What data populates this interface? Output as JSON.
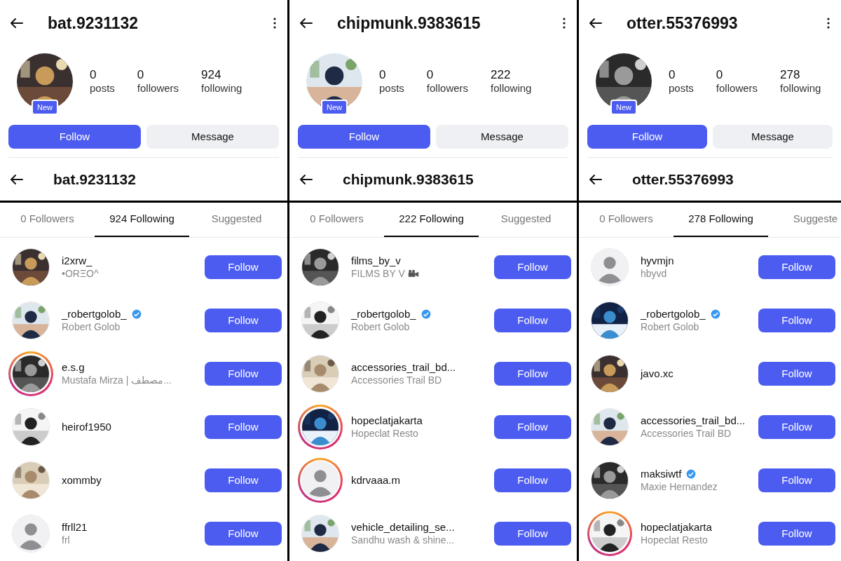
{
  "panels": [
    {
      "profile": {
        "username": "bat.9231132",
        "badge": "New",
        "stats": [
          {
            "value": "0",
            "label": "posts"
          },
          {
            "value": "0",
            "label": "followers"
          },
          {
            "value": "924",
            "label": "following"
          }
        ],
        "follow": "Follow",
        "message": "Message"
      },
      "list_title": "bat.9231132",
      "tabs": [
        {
          "label": "0 Followers",
          "selected": false
        },
        {
          "label": "924 Following",
          "selected": true
        },
        {
          "label": "Suggested",
          "selected": false
        }
      ],
      "users": [
        {
          "username": "i2xrw_",
          "subtitle": "•ORΞO^",
          "verified": false,
          "story_ring": false,
          "has_photo": true,
          "follow": "Follow"
        },
        {
          "username": "_robertgolob_",
          "subtitle": "Robert Golob",
          "verified": true,
          "story_ring": false,
          "has_photo": true,
          "follow": "Follow"
        },
        {
          "username": "e.s.g",
          "subtitle": "Mustafa Mirza | مصطف...",
          "verified": false,
          "story_ring": true,
          "has_photo": true,
          "follow": "Follow"
        },
        {
          "username": "heirof1950",
          "verified": false,
          "story_ring": false,
          "has_photo": true,
          "follow": "Follow"
        },
        {
          "username": "xommby",
          "verified": false,
          "story_ring": false,
          "has_photo": true,
          "follow": "Follow"
        },
        {
          "username": "ffrll21",
          "subtitle": "frl",
          "verified": false,
          "story_ring": false,
          "has_photo": false,
          "follow": "Follow"
        }
      ]
    },
    {
      "profile": {
        "username": "chipmunk.9383615",
        "badge": "New",
        "stats": [
          {
            "value": "0",
            "label": "posts"
          },
          {
            "value": "0",
            "label": "followers"
          },
          {
            "value": "222",
            "label": "following"
          }
        ],
        "follow": "Follow",
        "message": "Message"
      },
      "list_title": "chipmunk.9383615",
      "tabs": [
        {
          "label": "0 Followers",
          "selected": false
        },
        {
          "label": "222 Following",
          "selected": true
        },
        {
          "label": "Suggested",
          "selected": false
        }
      ],
      "users": [
        {
          "username": "films_by_v",
          "subtitle": "FILMS BY V",
          "verified": false,
          "story_ring": false,
          "has_photo": true,
          "follow": "Follow"
        },
        {
          "username": "_robertgolob_",
          "subtitle": "Robert Golob",
          "verified": true,
          "story_ring": false,
          "has_photo": true,
          "follow": "Follow"
        },
        {
          "username": "accessories_trail_bd...",
          "subtitle": "Accessories Trail BD",
          "verified": false,
          "story_ring": false,
          "has_photo": true,
          "follow": "Follow"
        },
        {
          "username": "hopeclatjakarta",
          "subtitle": "Hopeclat Resto",
          "verified": false,
          "story_ring": true,
          "has_photo": true,
          "follow": "Follow"
        },
        {
          "username": "kdrvaaa.m",
          "verified": false,
          "story_ring": true,
          "has_photo": false,
          "follow": "Follow"
        },
        {
          "username": "vehicle_detailing_se...",
          "subtitle": "Sandhu wash & shine...",
          "verified": false,
          "story_ring": false,
          "has_photo": true,
          "follow": "Follow"
        }
      ]
    },
    {
      "profile": {
        "username": "otter.55376993",
        "badge": "New",
        "stats": [
          {
            "value": "0",
            "label": "posts"
          },
          {
            "value": "0",
            "label": "followers"
          },
          {
            "value": "278",
            "label": "following"
          }
        ],
        "follow": "Follow",
        "message": "Message"
      },
      "list_title": "otter.55376993",
      "tabs": [
        {
          "label": "0 Followers",
          "selected": false
        },
        {
          "label": "278 Following",
          "selected": true
        },
        {
          "label": "Suggeste",
          "selected": false
        }
      ],
      "users": [
        {
          "username": "hyvmjn",
          "subtitle": "hbyvd",
          "verified": false,
          "story_ring": false,
          "has_photo": false,
          "follow": "Follow"
        },
        {
          "username": "_robertgolob_",
          "subtitle": "Robert Golob",
          "verified": true,
          "story_ring": false,
          "has_photo": true,
          "follow": "Follow"
        },
        {
          "username": "javo.xc",
          "verified": false,
          "story_ring": false,
          "has_photo": true,
          "follow": "Follow"
        },
        {
          "username": "accessories_trail_bd...",
          "subtitle": "Accessories Trail BD",
          "verified": false,
          "story_ring": false,
          "has_photo": true,
          "follow": "Follow"
        },
        {
          "username": "maksiwtf",
          "subtitle": "Maxie Hernandez",
          "verified": true,
          "story_ring": false,
          "has_photo": true,
          "follow": "Follow"
        },
        {
          "username": "hopeclatjakarta",
          "subtitle": "Hopeclat Resto",
          "verified": false,
          "story_ring": true,
          "has_photo": true,
          "follow": "Follow"
        }
      ]
    }
  ]
}
